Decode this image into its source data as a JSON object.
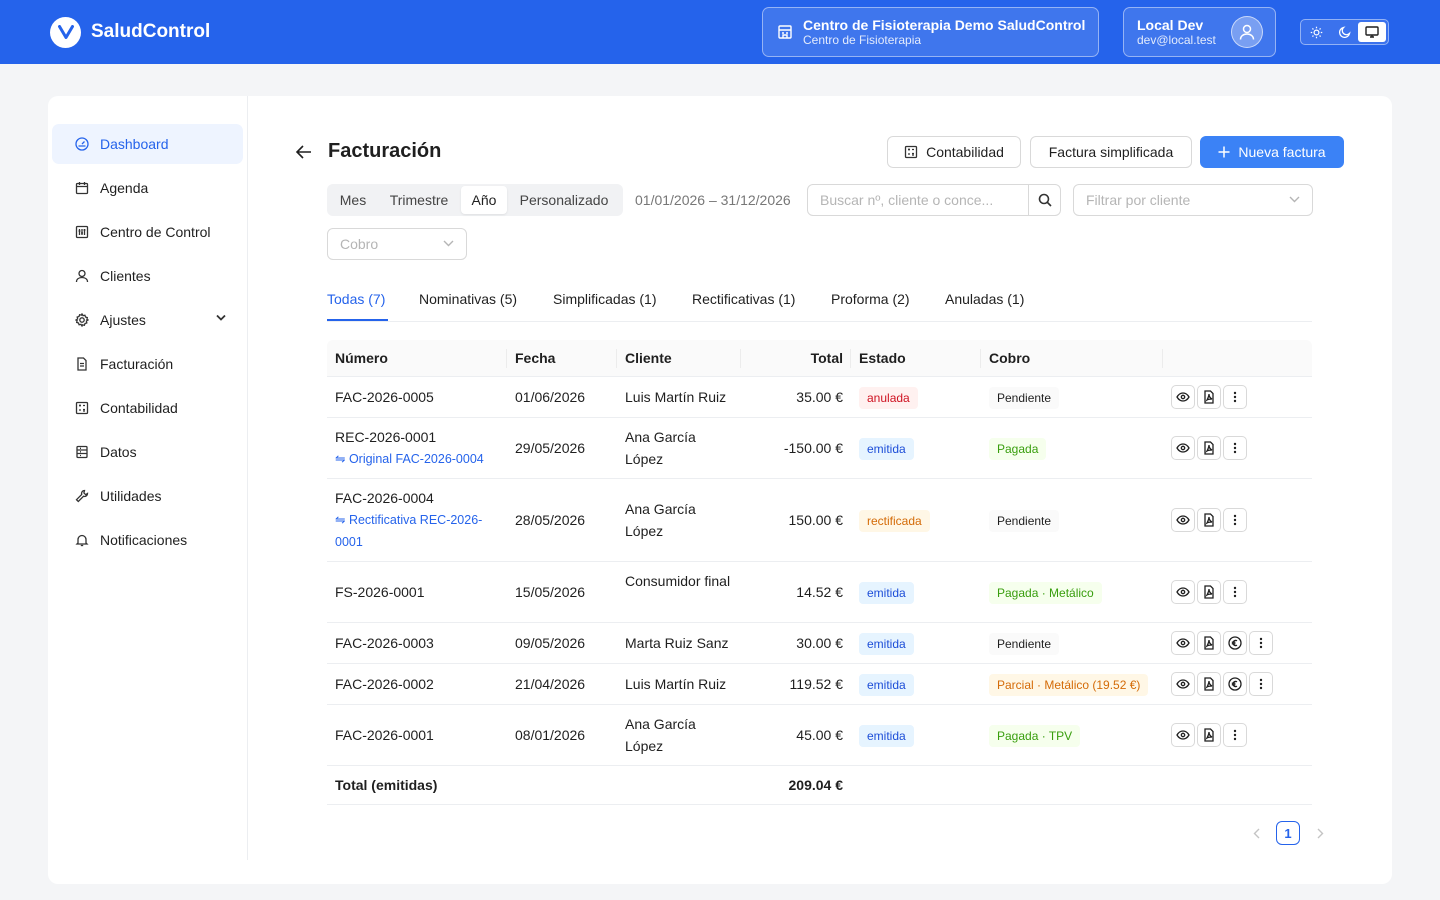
{
  "app": {
    "name": "SaludControl"
  },
  "header": {
    "clinic_title": "Centro de Fisioterapia Demo SaludControl",
    "clinic_subtitle": "Centro de Fisioterapia",
    "user_name": "Local Dev",
    "user_email": "dev@local.test",
    "theme_modes": [
      "light",
      "dark",
      "system"
    ],
    "theme_selected": "system"
  },
  "colors": {
    "primary": "#2563eb",
    "button": "#3b82f6"
  },
  "sidebar": {
    "items": [
      {
        "label": "Dashboard",
        "icon": "dashboard-icon"
      },
      {
        "label": "Agenda",
        "icon": "calendar-icon"
      },
      {
        "label": "Centro de Control",
        "icon": "control-icon"
      },
      {
        "label": "Clientes",
        "icon": "user-icon"
      },
      {
        "label": "Ajustes",
        "icon": "gear-icon"
      },
      {
        "label": "Facturación",
        "icon": "invoice-icon"
      },
      {
        "label": "Contabilidad",
        "icon": "calculator-icon"
      },
      {
        "label": "Datos",
        "icon": "database-icon"
      },
      {
        "label": "Utilidades",
        "icon": "tool-icon"
      },
      {
        "label": "Notificaciones",
        "icon": "bell-icon"
      }
    ]
  },
  "page": {
    "title": "Facturación",
    "buttons": {
      "accounting": "Contabilidad",
      "simplified": "Factura simplificada",
      "new": "Nueva factura"
    }
  },
  "filters": {
    "periods": [
      "Mes",
      "Trimestre",
      "Año",
      "Personalizado"
    ],
    "period_selected": "Año",
    "date_range": "01/01/2026 – 31/12/2026",
    "search_placeholder": "Buscar nº, cliente o conce...",
    "client_placeholder": "Filtrar por cliente",
    "payment_placeholder": "Cobro"
  },
  "tabs": [
    {
      "label": "Todas (7)",
      "active": true
    },
    {
      "label": "Nominativas (5)"
    },
    {
      "label": "Simplificadas (1)"
    },
    {
      "label": "Rectificativas (1)"
    },
    {
      "label": "Proforma (2)"
    },
    {
      "label": "Anuladas (1)"
    }
  ],
  "table": {
    "columns": [
      "Número",
      "Fecha",
      "Cliente",
      "Total",
      "Estado",
      "Cobro"
    ],
    "rows": [
      {
        "number": "FAC-2026-0005",
        "date": "01/06/2026",
        "client": "Luis Martín Ruiz",
        "total": "35.00 €",
        "status": "anulada",
        "payment": "Pendiente"
      },
      {
        "number": "REC-2026-0001",
        "link": "⇋ Original FAC-2026-0004",
        "date": "29/05/2026",
        "client": "Ana García López",
        "total": "-150.00 €",
        "status": "emitida",
        "payment": "Pagada"
      },
      {
        "number": "FAC-2026-0004",
        "link": "⇋ Rectificativa REC-2026-0001",
        "date": "28/05/2026",
        "client": "Ana García López",
        "total": "150.00 €",
        "status": "rectificada",
        "payment": "Pendiente"
      },
      {
        "number": "FS-2026-0001",
        "date": "15/05/2026",
        "client": "Consumidor final",
        "total": "14.52 €",
        "status": "emitida",
        "payment": "Pagada · Metálico"
      },
      {
        "number": "FAC-2026-0003",
        "date": "09/05/2026",
        "client": "Marta Ruiz Sanz",
        "total": "30.00 €",
        "status": "emitida",
        "payment": "Pendiente"
      },
      {
        "number": "FAC-2026-0002",
        "date": "21/04/2026",
        "client": "Luis Martín Ruiz",
        "total": "119.52 €",
        "status": "emitida",
        "payment": "Parcial · Metálico (19.52 €)"
      },
      {
        "number": "FAC-2026-0001",
        "date": "08/01/2026",
        "client": "Ana García López",
        "total": "45.00 €",
        "status": "emitida",
        "payment": "Pagada · TPV"
      }
    ],
    "footer_label": "Total (emitidas)",
    "footer_total": "209.04 €"
  },
  "pagination": {
    "current": "1"
  }
}
